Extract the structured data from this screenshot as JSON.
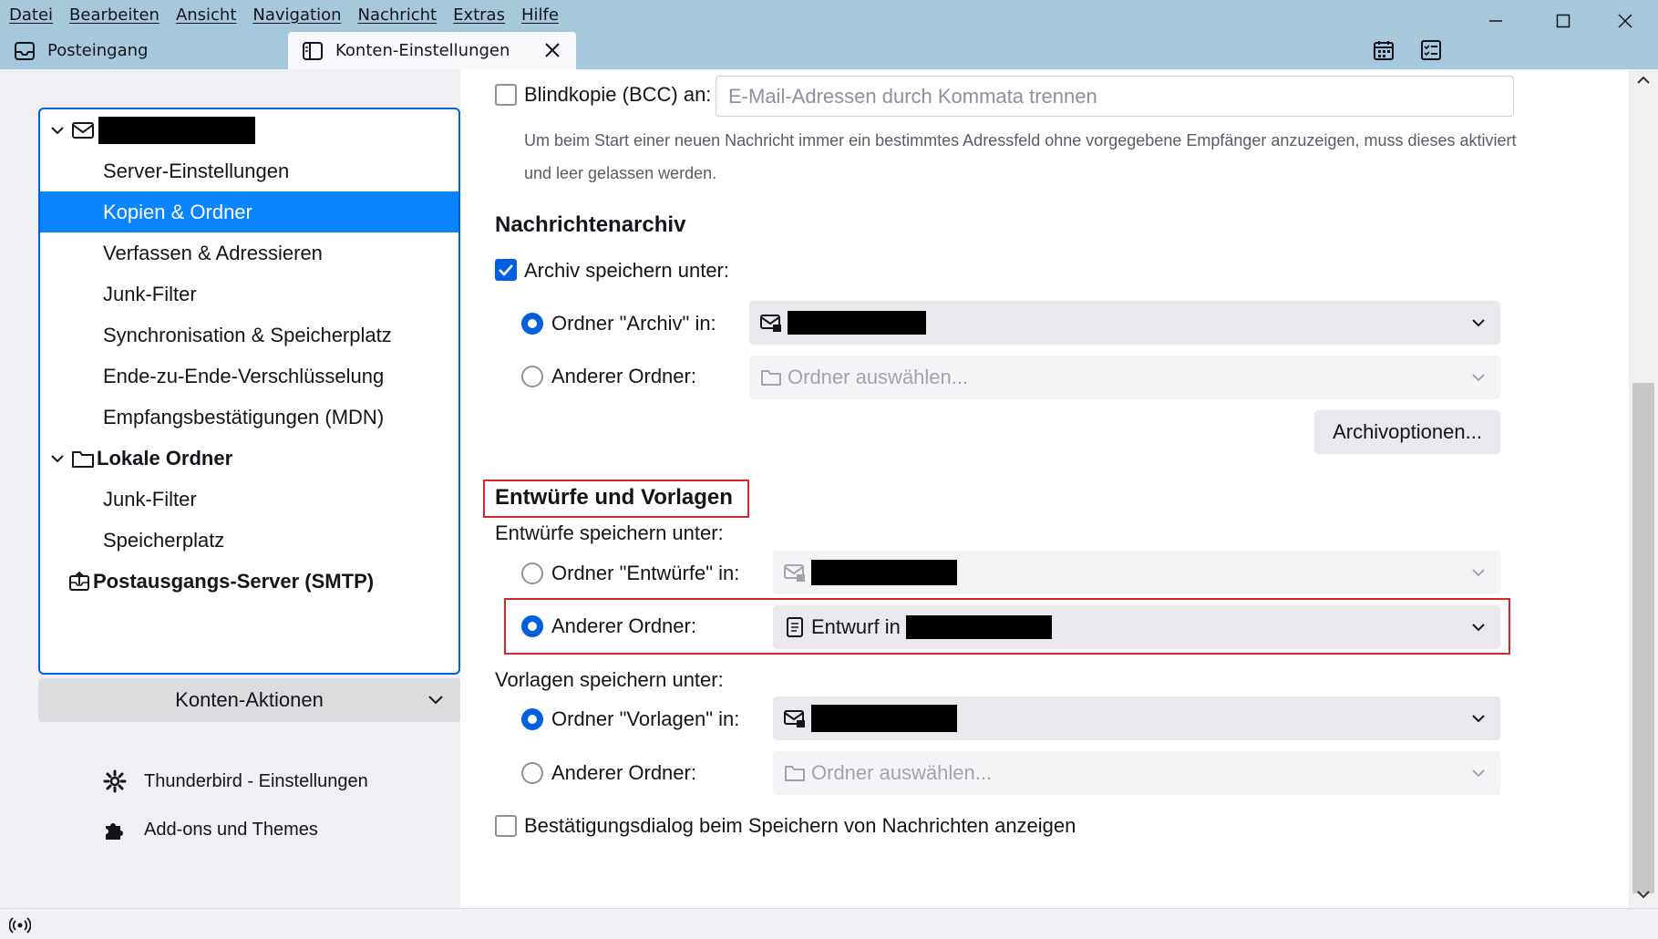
{
  "menubar": {
    "items": [
      "Datei",
      "Bearbeiten",
      "Ansicht",
      "Navigation",
      "Nachricht",
      "Extras",
      "Hilfe"
    ]
  },
  "tabs": [
    {
      "label": "Posteingang",
      "icon": "inbox-icon"
    },
    {
      "label": "Konten-Einstellungen",
      "icon": "account-settings-icon"
    }
  ],
  "sidebar": {
    "account_tree": [
      {
        "type": "account",
        "label": "",
        "icon": "mail-icon"
      },
      {
        "type": "child",
        "label": "Server-Einstellungen"
      },
      {
        "type": "child",
        "label": "Kopien & Ordner",
        "selected": true
      },
      {
        "type": "child",
        "label": "Verfassen & Adressieren"
      },
      {
        "type": "child",
        "label": "Junk-Filter"
      },
      {
        "type": "child",
        "label": "Synchronisation & Speicherplatz"
      },
      {
        "type": "child",
        "label": "Ende-zu-Ende-Verschlüsselung"
      },
      {
        "type": "child",
        "label": "Empfangsbestätigungen (MDN)"
      },
      {
        "type": "account",
        "label": "Lokale Ordner",
        "icon": "folder-icon"
      },
      {
        "type": "child",
        "label": "Junk-Filter"
      },
      {
        "type": "child",
        "label": "Speicherplatz"
      },
      {
        "type": "smtp",
        "label": "Postausgangs-Server (SMTP)",
        "icon": "outbox-icon"
      }
    ],
    "account_actions_label": "Konten-Aktionen",
    "settings_link": "Thunderbird - Einstellungen",
    "addons_link": "Add-ons und Themes"
  },
  "content": {
    "bcc_label": "Blindkopie (BCC) an:",
    "bcc_checked": false,
    "bcc_placeholder": "E-Mail-Adressen durch Kommata trennen",
    "bcc_hint": "Um beim Start einer neuen Nachricht immer ein bestimmtes Adressfeld ohne vorgegebene Empfänger anzuzeigen, muss dieses aktiviert und leer gelassen werden.",
    "archive": {
      "heading": "Nachrichtenarchiv",
      "save_label": "Archiv speichern unter:",
      "save_checked": true,
      "folder_radio_label": "Ordner \"Archiv\" in:",
      "other_radio_label": "Anderer Ordner:",
      "other_placeholder": "Ordner auswählen...",
      "options_button": "Archivoptionen..."
    },
    "drafts": {
      "heading": "Entwürfe und Vorlagen",
      "drafts_label": "Entwürfe speichern unter:",
      "drafts_folder_radio": "Ordner \"Entwürfe\" in:",
      "drafts_other_radio": "Anderer Ordner:",
      "drafts_other_value": "Entwurf in",
      "templates_label": "Vorlagen speichern unter:",
      "templates_folder_radio": "Ordner \"Vorlagen\" in:",
      "templates_other_radio": "Anderer Ordner:",
      "templates_other_placeholder": "Ordner auswählen...",
      "confirm_label": "Bestätigungsdialog beim Speichern von Nachrichten anzeigen",
      "confirm_checked": false
    }
  },
  "colors": {
    "accent": "#0060df",
    "selection": "#0a84ff",
    "highlight": "#d7262e",
    "titlebar": "#a6c8dc"
  }
}
